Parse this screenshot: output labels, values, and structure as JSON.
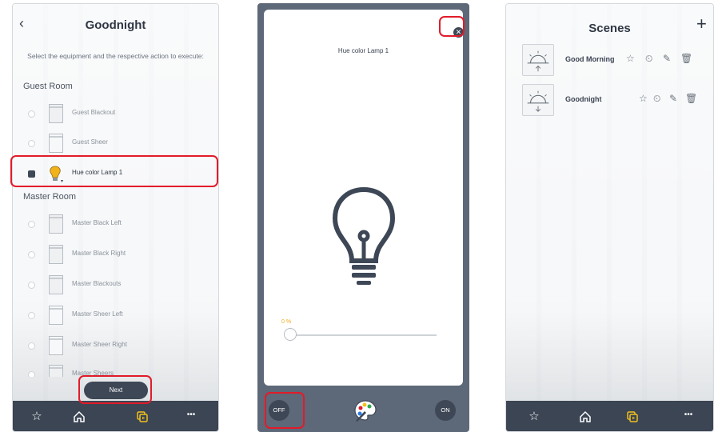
{
  "screen1": {
    "title": "Goodnight",
    "back_icon": "chevron-left-icon",
    "instruction": "Select the equipment and the respective action to execute:",
    "sections": [
      {
        "name": "Guest Room",
        "items": [
          {
            "label": "Guest Blackout",
            "selected": false,
            "icon": "blackout-blind-icon"
          },
          {
            "label": "Guest Sheer",
            "selected": false,
            "icon": "sheer-blind-icon"
          },
          {
            "label": "Hue color Lamp 1",
            "selected": true,
            "icon": "lamp-icon"
          }
        ]
      },
      {
        "name": "Master Room",
        "items": [
          {
            "label": "Master Black Left",
            "selected": false,
            "icon": "blackout-blind-icon"
          },
          {
            "label": "Master Black Right",
            "selected": false,
            "icon": "blackout-blind-icon"
          },
          {
            "label": "Master Blackouts",
            "selected": false,
            "icon": "blind-group-icon"
          },
          {
            "label": "Master Sheer Left",
            "selected": false,
            "icon": "sheer-blind-icon"
          },
          {
            "label": "Master Sheer Right",
            "selected": false,
            "icon": "sheer-blind-icon"
          },
          {
            "label": "Master Sheers",
            "selected": false,
            "icon": "blind-group-icon"
          }
        ]
      }
    ],
    "next_label": "Next"
  },
  "screen2": {
    "title": "Hue color Lamp 1",
    "close_icon": "close-icon",
    "brightness_label": "0 %",
    "brightness_value": 0,
    "off_label": "OFF",
    "on_label": "ON",
    "palette_icon": "color-palette-icon"
  },
  "screen3": {
    "title": "Scenes",
    "add_icon": "plus-icon",
    "scenes": [
      {
        "name": "Good Morning",
        "icon": "sunrise-icon"
      },
      {
        "name": "Goodnight",
        "icon": "sunset-icon"
      }
    ]
  },
  "tabbar": {
    "tabs": [
      {
        "icon": "star-icon",
        "active": false
      },
      {
        "icon": "home-icon",
        "active": false
      },
      {
        "icon": "scenes-icon",
        "active": true
      },
      {
        "icon": "more-icon",
        "active": false
      }
    ],
    "more_glyph": "•••"
  },
  "colors": {
    "highlight": "#e21b2a",
    "dark": "#3b4554",
    "accent": "#f2c21b"
  }
}
